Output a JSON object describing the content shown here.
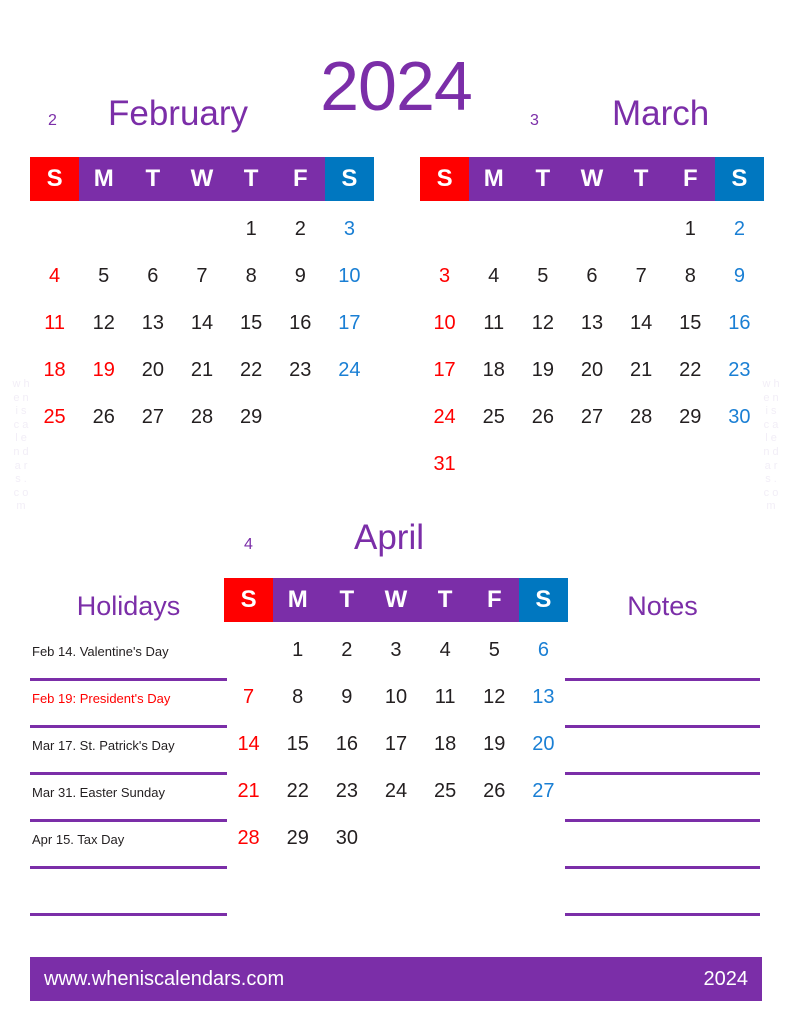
{
  "year_title": "2024",
  "colors": {
    "purple": "#7B2EA8",
    "sunday_red": "#FF0000",
    "saturday_blue": "#0077C0",
    "day_text": "#231f20",
    "saturday_text": "#1a7fd4"
  },
  "watermark": {
    "left": "w h e n i s c a l e n d a r s . c o m",
    "right": "w h e n i s c a l e n d a r s . c o m"
  },
  "dow": {
    "sun": "S",
    "mon": "M",
    "tue": "T",
    "wed": "W",
    "thu": "T",
    "fri": "F",
    "sat": "S"
  },
  "months": [
    {
      "number": "2",
      "name": "February",
      "weeks": [
        [
          "",
          "",
          "",
          "",
          "1",
          "2",
          "3"
        ],
        [
          "4",
          "5",
          "6",
          "7",
          "8",
          "9",
          "10"
        ],
        [
          "11",
          "12",
          "13",
          "14",
          "15",
          "16",
          "17"
        ],
        [
          "18",
          "19",
          "20",
          "21",
          "22",
          "23",
          "24"
        ],
        [
          "25",
          "26",
          "27",
          "28",
          "29",
          "",
          ""
        ]
      ],
      "holiday_days": [
        "19"
      ]
    },
    {
      "number": "3",
      "name": "March",
      "weeks": [
        [
          "",
          "",
          "",
          "",
          "",
          "1",
          "2"
        ],
        [
          "3",
          "4",
          "5",
          "6",
          "7",
          "8",
          "9"
        ],
        [
          "10",
          "11",
          "12",
          "13",
          "14",
          "15",
          "16"
        ],
        [
          "17",
          "18",
          "19",
          "20",
          "21",
          "22",
          "23"
        ],
        [
          "24",
          "25",
          "26",
          "27",
          "28",
          "29",
          "30"
        ],
        [
          "31",
          "",
          "",
          "",
          "",
          "",
          ""
        ]
      ],
      "holiday_days": []
    },
    {
      "number": "4",
      "name": "April",
      "weeks": [
        [
          "",
          "1",
          "2",
          "3",
          "4",
          "5",
          "6"
        ],
        [
          "7",
          "8",
          "9",
          "10",
          "11",
          "12",
          "13"
        ],
        [
          "14",
          "15",
          "16",
          "17",
          "18",
          "19",
          "20"
        ],
        [
          "21",
          "22",
          "23",
          "24",
          "25",
          "26",
          "27"
        ],
        [
          "28",
          "29",
          "30",
          "",
          "",
          "",
          ""
        ]
      ],
      "holiday_days": []
    }
  ],
  "holidays": {
    "title": "Holidays",
    "items": [
      {
        "text": "Feb 14. Valentine's Day",
        "highlight": false
      },
      {
        "text": "Feb 19: President's Day",
        "highlight": true
      },
      {
        "text": "Mar 17. St. Patrick's Day",
        "highlight": false
      },
      {
        "text": "Mar 31. Easter Sunday",
        "highlight": false
      },
      {
        "text": "Apr 15. Tax Day",
        "highlight": false
      },
      {
        "text": "",
        "highlight": false
      }
    ]
  },
  "notes": {
    "title": "Notes",
    "items": [
      {
        "text": ""
      },
      {
        "text": ""
      },
      {
        "text": ""
      },
      {
        "text": ""
      },
      {
        "text": ""
      },
      {
        "text": ""
      }
    ]
  },
  "footer": {
    "url": "www.wheniscalendars.com",
    "year": "2024"
  }
}
